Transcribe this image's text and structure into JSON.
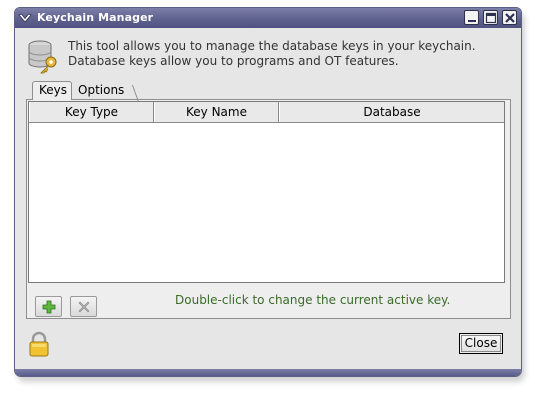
{
  "window": {
    "title": "Keychain Manager"
  },
  "info": {
    "line1": "This tool allows you to manage the database keys in your keychain.",
    "line2": "Database keys allow you to programs and OT features."
  },
  "tabs": [
    {
      "label": "Keys",
      "selected": true
    },
    {
      "label": "Options",
      "selected": false
    }
  ],
  "table": {
    "columns": [
      "Key Type",
      "Key Name",
      "Database"
    ],
    "rows": []
  },
  "toolbar": {
    "add_icon": "add-icon",
    "remove_icon": "remove-icon",
    "hint": "Double-click to change the current active key."
  },
  "footer": {
    "lock_icon": "padlock-icon",
    "close_label": "Close"
  },
  "colors": {
    "titlebar": "#5f628d",
    "hint_text": "#3a6b2a",
    "add_green": "#3a9a2a"
  }
}
